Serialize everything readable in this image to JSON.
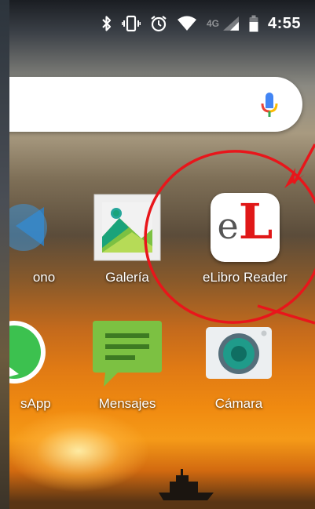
{
  "status_bar": {
    "time": "4:55",
    "network": "4G",
    "icons": [
      "bluetooth-icon",
      "vibrate-icon",
      "alarm-icon",
      "wifi-icon",
      "signal-icon",
      "battery-icon"
    ]
  },
  "search_bar": {
    "mic_icon": "mic-icon"
  },
  "apps": {
    "phone": {
      "label": "ono",
      "icon": "phone-icon"
    },
    "gallery": {
      "label": "Galería",
      "icon": "gallery-icon"
    },
    "elibro": {
      "label": "eLibro Reader",
      "icon_e": "e",
      "icon_L": "L"
    },
    "whatsapp": {
      "label": "sApp",
      "icon": "whatsapp-icon"
    },
    "messages": {
      "label": "Mensajes",
      "icon": "messages-icon"
    },
    "camera": {
      "label": "Cámara",
      "icon": "camera-icon"
    }
  },
  "colors": {
    "annotation": "#e8161b",
    "google_blue": "#4285f4",
    "google_red": "#ea4335",
    "google_yellow": "#fbbc05",
    "google_green": "#34a853",
    "messages_green": "#7cc142",
    "camera_teal": "#1f9b8a"
  }
}
